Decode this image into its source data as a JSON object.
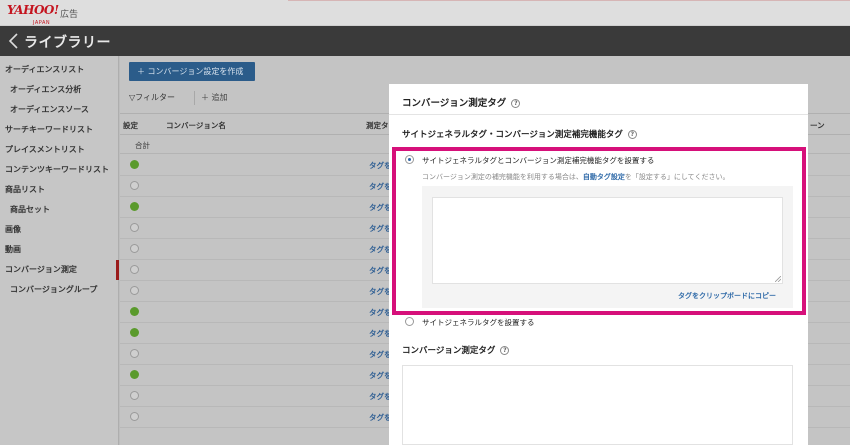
{
  "brand": {
    "logo_text": "YAHOO!",
    "logo_sub": "JAPAN",
    "logo_ad": "広告"
  },
  "titlebar": {
    "title": "ライブラリー"
  },
  "sidebar": {
    "items": [
      {
        "label": "オーディエンスリスト",
        "sub": false
      },
      {
        "label": "オーディエンス分析",
        "sub": true
      },
      {
        "label": "オーディエンスソース",
        "sub": true
      },
      {
        "label": "サーチキーワードリスト",
        "sub": false
      },
      {
        "label": "プレイスメントリスト",
        "sub": false
      },
      {
        "label": "コンテンツキーワードリスト",
        "sub": false
      },
      {
        "label": "商品リスト",
        "sub": false
      },
      {
        "label": "商品セット",
        "sub": true
      },
      {
        "label": "画像",
        "sub": false
      },
      {
        "label": "動画",
        "sub": false
      },
      {
        "label": "コンバージョン測定",
        "sub": false,
        "active": true
      },
      {
        "label": "コンバージョングループ",
        "sub": true
      }
    ]
  },
  "toolbar": {
    "create_label": "＋ コンバージョン設定を作成",
    "filter_label": "▽フィルター",
    "add_label": "＋ 追加"
  },
  "table": {
    "headers": {
      "setting": "設定",
      "name": "コンバージョン名",
      "tag": "測定タ",
      "right": "ーン"
    },
    "total_label": "合計",
    "tag_link_label": "タグを",
    "rows": [
      "green",
      "empty",
      "green",
      "empty",
      "empty",
      "empty",
      "empty",
      "green",
      "green",
      "empty",
      "green",
      "empty",
      "empty"
    ]
  },
  "modal": {
    "title": "コンバージョン測定タグ",
    "site_general_section": "サイトジェネラルタグ・コンバージョン測定補完機能タグ",
    "option_with_supplement": "サイトジェネラルタグとコンバージョン測定補完機能タグを設置する",
    "note_prefix": "コンバージョン測定の補完機能を利用する場合は、",
    "note_link": "自動タグ設定",
    "note_suffix": "を「設定する」にしてください。",
    "copy_link": "タグをクリップボードにコピー",
    "option_site_only": "サイトジェネラルタグを設置する",
    "conversion_tag_section": "コンバージョン測定タグ",
    "help_glyph": "?"
  },
  "colors": {
    "highlight": "#d6107a",
    "primary_button": "#2b5c8a",
    "link": "#2f6aa8",
    "active_green": "#5a9a2c"
  }
}
